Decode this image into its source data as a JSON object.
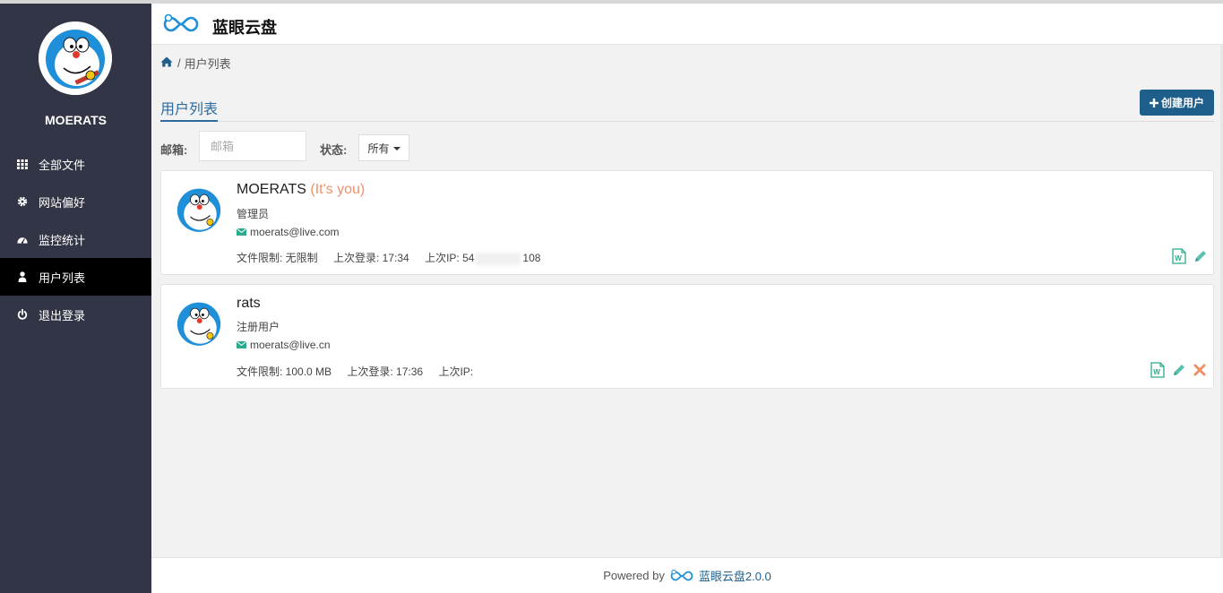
{
  "app": {
    "brand": "蓝眼云盘",
    "accent": "#1d5f8a"
  },
  "sidebar": {
    "username": "MOERATS",
    "items": [
      {
        "label": "全部文件",
        "icon": "grid-icon"
      },
      {
        "label": "网站偏好",
        "icon": "gear-icon"
      },
      {
        "label": "监控统计",
        "icon": "dashboard-icon"
      },
      {
        "label": "用户列表",
        "icon": "user-icon",
        "active": true
      },
      {
        "label": "退出登录",
        "icon": "power-icon"
      }
    ]
  },
  "breadcrumb": {
    "current": "用户列表",
    "separator": "/"
  },
  "tabs": {
    "active": "用户列表"
  },
  "toolbar": {
    "create_label": "创建用户"
  },
  "filters": {
    "email_label": "邮箱:",
    "email_placeholder": "邮箱",
    "status_label": "状态:",
    "status_value": "所有"
  },
  "users": [
    {
      "name": "MOERATS",
      "tag": "(It's you)",
      "role": "管理员",
      "email": "moerats@live.com",
      "size_limit": "文件限制: 无限制",
      "last_login": "上次登录: 17:34",
      "last_ip_prefix": "上次IP: 54",
      "last_ip_suffix": "108"
    },
    {
      "name": "rats",
      "tag": "",
      "role": "注册用户",
      "email": "moerats@live.cn",
      "size_limit": "文件限制: 100.0 MB",
      "last_login": "上次登录: 17:36",
      "last_ip_prefix": "上次IP:",
      "last_ip_suffix": ""
    }
  ],
  "footer": {
    "powered": "Powered by",
    "brand": "蓝眼云盘2.0.0"
  }
}
